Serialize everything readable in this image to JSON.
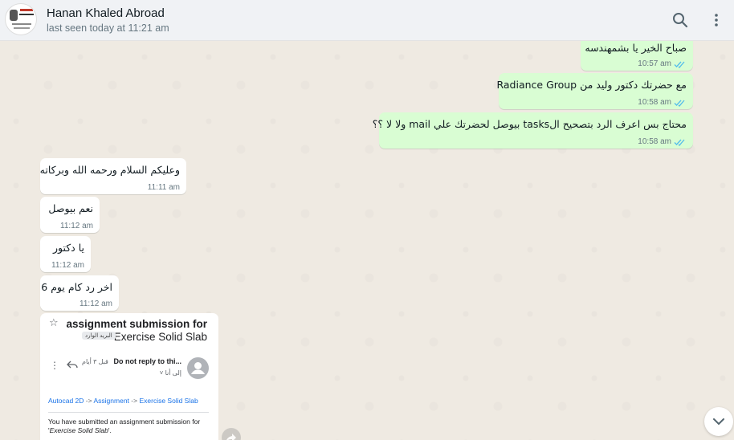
{
  "header": {
    "contact_name": "Hanan Khaled Abroad",
    "status": "last seen today at 11:21 am",
    "search_icon": "search-icon",
    "menu_icon": "kebab-menu-icon"
  },
  "messages": [
    {
      "direction": "out",
      "text": "صباح الخير يا بشمهندسه",
      "time": "10:57 am",
      "status": "read"
    },
    {
      "direction": "out",
      "text": "مع حضرتك دكتور وليد من Radiance Group",
      "time": "10:58 am",
      "status": "read"
    },
    {
      "direction": "out",
      "text": "محتاج بس اعرف الرد بتصحيح الtasks بيوصل لحضرتك علي mail ولا لا ؟؟",
      "time": "10:58 am",
      "status": "read"
    },
    {
      "direction": "in",
      "text": "وعليكم السلام ورحمه الله وبركاته",
      "time": "11:11 am"
    },
    {
      "direction": "in",
      "text": "نعم بيوصل",
      "time": "11:12 am"
    },
    {
      "direction": "in",
      "text": "يا دكتور",
      "time": "11:12 am"
    },
    {
      "direction": "in",
      "text": "اخر رد كام يوم 6",
      "time": "11:12 am"
    }
  ],
  "email_card": {
    "subject_line1": "assignment submission for",
    "subject_line2": "Exercise Solid Slab",
    "inbox_label": "البريد الوارد",
    "sender": "Do not reply to thi...",
    "sent_ago": "قبل ٣ أيام",
    "to_me": "إلى أنا",
    "breadcrumb": [
      "Autocad 2D",
      "Assignment",
      "Exercise Solid Slab"
    ],
    "body_text_prefix": "You have submitted an assignment submission for '",
    "body_text_item": "Exercise Solid Slab",
    "body_text_suffix": "'."
  },
  "colors": {
    "outgoing_bubble": "#d9fdd3",
    "incoming_bubble": "#ffffff",
    "chat_background": "#efeae2",
    "read_tick": "#53bdeb",
    "header_background": "#f0f2f5"
  }
}
